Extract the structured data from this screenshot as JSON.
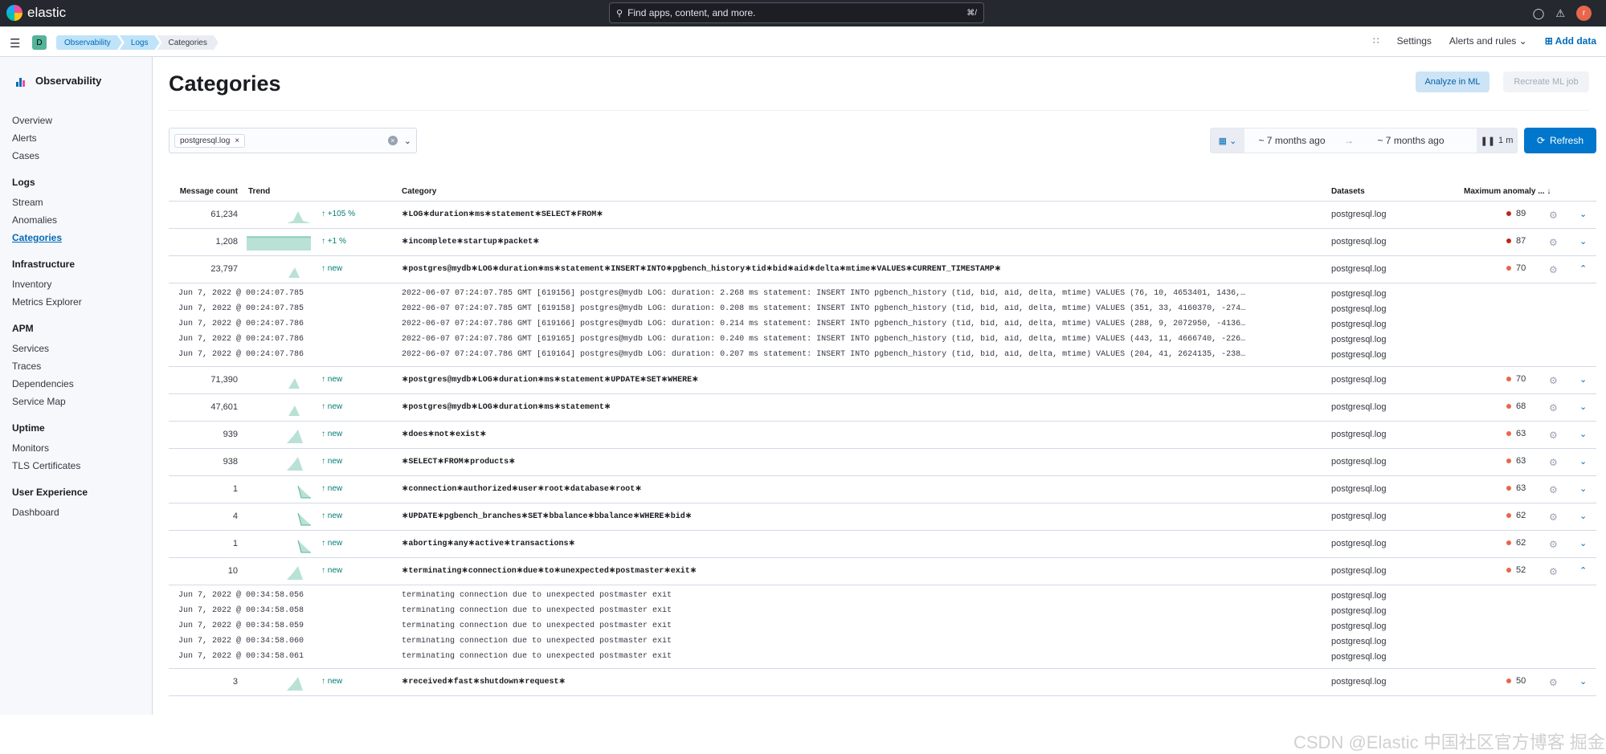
{
  "topbar": {
    "brand": "elastic",
    "search_placeholder": "Find apps, content, and more.",
    "search_shortcut": "⌘/",
    "avatar_letter": "r"
  },
  "subbar": {
    "space_letter": "D",
    "breadcrumbs": [
      "Observability",
      "Logs",
      "Categories"
    ],
    "settings": "Settings",
    "alerts": "Alerts and rules",
    "add_data": "Add data"
  },
  "sidebar": {
    "title": "Observability",
    "top_items": [
      "Overview",
      "Alerts",
      "Cases"
    ],
    "groups": [
      {
        "label": "Logs",
        "items": [
          "Stream",
          "Anomalies",
          "Categories"
        ]
      },
      {
        "label": "Infrastructure",
        "items": [
          "Inventory",
          "Metrics Explorer"
        ]
      },
      {
        "label": "APM",
        "items": [
          "Services",
          "Traces",
          "Dependencies",
          "Service Map"
        ]
      },
      {
        "label": "Uptime",
        "items": [
          "Monitors",
          "TLS Certificates"
        ]
      },
      {
        "label": "User Experience",
        "items": [
          "Dashboard"
        ]
      }
    ],
    "active": "Categories"
  },
  "page": {
    "title": "Categories",
    "analyze_btn": "Analyze in ML",
    "recreate_btn": "Recreate ML job",
    "filter_chip": "postgresql.log",
    "date_start": "~ 7 months ago",
    "date_end": "~ 7 months ago",
    "auto_refresh": "1 m",
    "refresh_btn": "Refresh"
  },
  "table": {
    "headers": {
      "count": "Message count",
      "trend": "Trend",
      "category": "Category",
      "datasets": "Datasets",
      "anomaly": "Maximum anomaly ...  ↓"
    },
    "rows": [
      {
        "count": "61,234",
        "trend_label": "↑ +105 %",
        "trend_shape": "rise",
        "category": "∗LOG∗duration∗ms∗statement∗SELECT∗FROM∗",
        "dataset": "postgresql.log",
        "score": "89",
        "color": "#bd271e",
        "expanded": false
      },
      {
        "count": "1,208",
        "trend_label": "↑ +1 %",
        "trend_shape": "flat",
        "category": "∗incomplete∗startup∗packet∗",
        "dataset": "postgresql.log",
        "score": "87",
        "color": "#bd271e",
        "expanded": false
      },
      {
        "count": "23,797",
        "trend_label": "↑ new",
        "trend_shape": "spike",
        "category": "∗postgres@mydb∗LOG∗duration∗ms∗statement∗INSERT∗INTO∗pgbench_history∗tid∗bid∗aid∗delta∗mtime∗VALUES∗CURRENT_TIMESTAMP∗",
        "dataset": "postgresql.log",
        "score": "70",
        "color": "#e7664c",
        "expanded": true,
        "examples": [
          {
            "ts": "Jun 7, 2022 @ 00:24:07.785",
            "msg": "2022-06-07 07:24:07.785 GMT [619156] postgres@mydb LOG: duration: 2.268 ms statement: INSERT INTO pgbench_history (tid, bid, aid, delta, mtime) VALUES (76, 10, 4653401, 1436,…",
            "ds": "postgresql.log"
          },
          {
            "ts": "Jun 7, 2022 @ 00:24:07.785",
            "msg": "2022-06-07 07:24:07.785 GMT [619158] postgres@mydb LOG: duration: 0.208 ms statement: INSERT INTO pgbench_history (tid, bid, aid, delta, mtime) VALUES (351, 33, 4160370, -274…",
            "ds": "postgresql.log"
          },
          {
            "ts": "Jun 7, 2022 @ 00:24:07.786",
            "msg": "2022-06-07 07:24:07.786 GMT [619166] postgres@mydb LOG: duration: 0.214 ms statement: INSERT INTO pgbench_history (tid, bid, aid, delta, mtime) VALUES (288, 9, 2072950, -4136…",
            "ds": "postgresql.log"
          },
          {
            "ts": "Jun 7, 2022 @ 00:24:07.786",
            "msg": "2022-06-07 07:24:07.786 GMT [619165] postgres@mydb LOG: duration: 0.240 ms statement: INSERT INTO pgbench_history (tid, bid, aid, delta, mtime) VALUES (443, 11, 4666740, -226…",
            "ds": "postgresql.log"
          },
          {
            "ts": "Jun 7, 2022 @ 00:24:07.786",
            "msg": "2022-06-07 07:24:07.786 GMT [619164] postgres@mydb LOG: duration: 0.207 ms statement: INSERT INTO pgbench_history (tid, bid, aid, delta, mtime) VALUES (204, 41, 2624135, -238…",
            "ds": "postgresql.log"
          }
        ]
      },
      {
        "count": "71,390",
        "trend_label": "↑ new",
        "trend_shape": "spike",
        "category": "∗postgres@mydb∗LOG∗duration∗ms∗statement∗UPDATE∗SET∗WHERE∗",
        "dataset": "postgresql.log",
        "score": "70",
        "color": "#e7664c",
        "expanded": false
      },
      {
        "count": "47,601",
        "trend_label": "↑ new",
        "trend_shape": "spike",
        "category": "∗postgres@mydb∗LOG∗duration∗ms∗statement∗",
        "dataset": "postgresql.log",
        "score": "68",
        "color": "#e7664c",
        "expanded": false
      },
      {
        "count": "939",
        "trend_label": "↑ new",
        "trend_shape": "bump",
        "category": "∗does∗not∗exist∗",
        "dataset": "postgresql.log",
        "score": "63",
        "color": "#e7664c",
        "expanded": false
      },
      {
        "count": "938",
        "trend_label": "↑ new",
        "trend_shape": "bump",
        "category": "∗SELECT∗FROM∗products∗",
        "dataset": "postgresql.log",
        "score": "63",
        "color": "#e7664c",
        "expanded": false
      },
      {
        "count": "1",
        "trend_label": "↑ new",
        "trend_shape": "drop",
        "category": "∗connection∗authorized∗user∗root∗database∗root∗",
        "dataset": "postgresql.log",
        "score": "63",
        "color": "#e7664c",
        "expanded": false
      },
      {
        "count": "4",
        "trend_label": "↑ new",
        "trend_shape": "drop",
        "category": "∗UPDATE∗pgbench_branches∗SET∗bbalance∗bbalance∗WHERE∗bid∗",
        "dataset": "postgresql.log",
        "score": "62",
        "color": "#e7664c",
        "expanded": false
      },
      {
        "count": "1",
        "trend_label": "↑ new",
        "trend_shape": "drop",
        "category": "∗aborting∗any∗active∗transactions∗",
        "dataset": "postgresql.log",
        "score": "62",
        "color": "#e7664c",
        "expanded": false
      },
      {
        "count": "10",
        "trend_label": "↑ new",
        "trend_shape": "bump",
        "category": "∗terminating∗connection∗due∗to∗unexpected∗postmaster∗exit∗",
        "dataset": "postgresql.log",
        "score": "52",
        "color": "#e7664c",
        "expanded": true,
        "examples": [
          {
            "ts": "Jun 7, 2022 @ 00:34:58.056",
            "msg": "terminating connection due to unexpected postmaster exit",
            "ds": "postgresql.log"
          },
          {
            "ts": "Jun 7, 2022 @ 00:34:58.058",
            "msg": "terminating connection due to unexpected postmaster exit",
            "ds": "postgresql.log"
          },
          {
            "ts": "Jun 7, 2022 @ 00:34:58.059",
            "msg": "terminating connection due to unexpected postmaster exit",
            "ds": "postgresql.log"
          },
          {
            "ts": "Jun 7, 2022 @ 00:34:58.060",
            "msg": "terminating connection due to unexpected postmaster exit",
            "ds": "postgresql.log"
          },
          {
            "ts": "Jun 7, 2022 @ 00:34:58.061",
            "msg": "terminating connection due to unexpected postmaster exit",
            "ds": "postgresql.log"
          }
        ]
      },
      {
        "count": "3",
        "trend_label": "↑ new",
        "trend_shape": "bump",
        "category": "∗received∗fast∗shutdown∗request∗",
        "dataset": "postgresql.log",
        "score": "50",
        "color": "#e7664c",
        "expanded": false
      }
    ]
  },
  "watermark": "CSDN @Elastic 中国社区官方博客 掘金技术社区 @ Elasticsearch"
}
